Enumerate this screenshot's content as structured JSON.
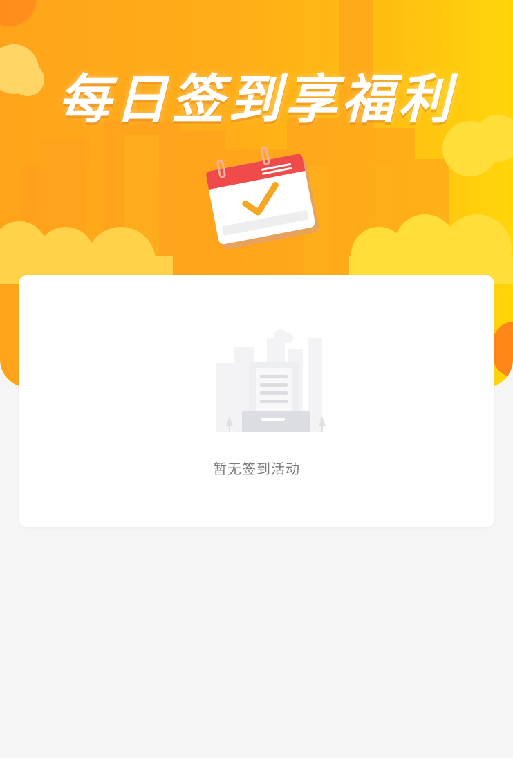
{
  "banner": {
    "title": "每日签到享福利",
    "icon": "calendar-check-icon",
    "colors": {
      "orange": "#ffa41a",
      "yellow": "#ffd60a",
      "calendar_red": "#ef4b4b",
      "check_orange": "#f5a623"
    }
  },
  "empty_state": {
    "icon": "empty-document-icon",
    "text": "暂无签到活动"
  },
  "colors": {
    "page_background": "#f5f5f5",
    "card_background": "#ffffff",
    "muted_text": "#7a7a7a"
  }
}
